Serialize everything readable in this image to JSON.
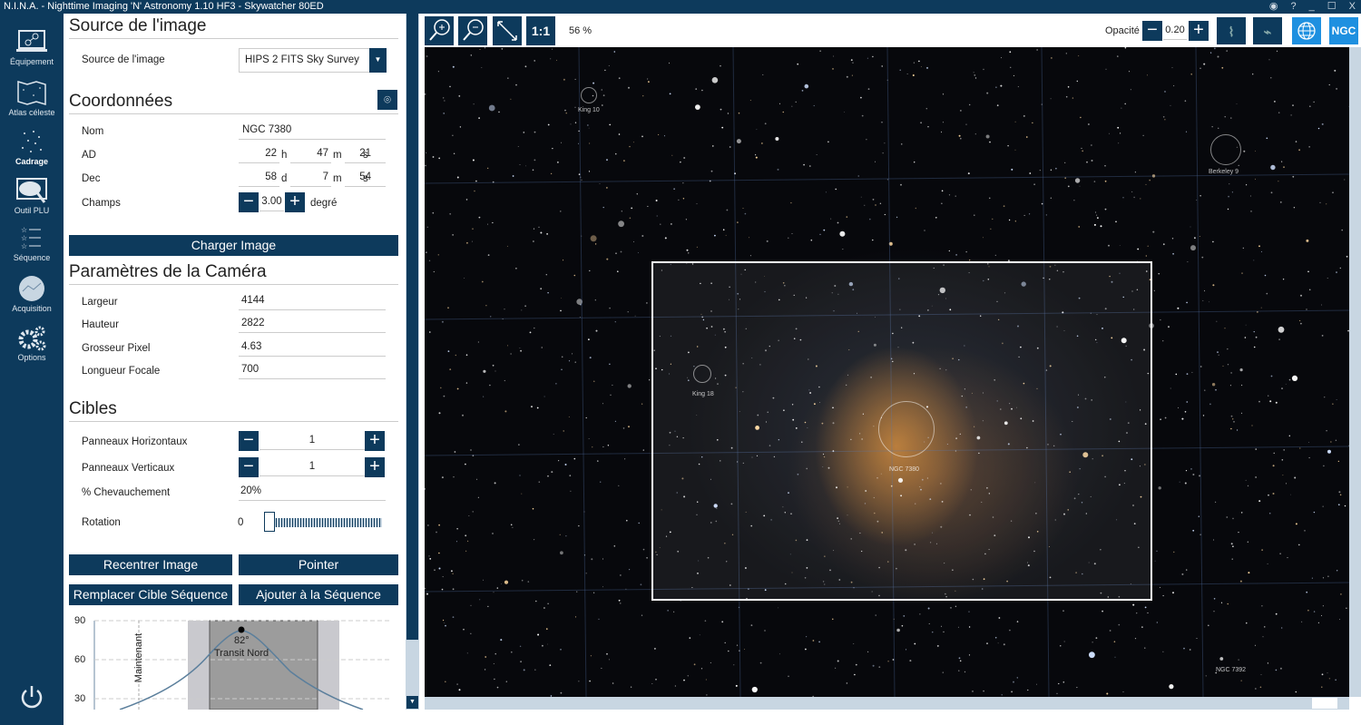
{
  "window": {
    "title": "N.I.N.A. - Nighttime Imaging 'N' Astronomy 1.10 HF3   -  Skywatcher 80ED",
    "controls": [
      "◉",
      "?",
      "_",
      "☐",
      "X"
    ]
  },
  "sidebar": {
    "items": [
      {
        "label": "Équipement",
        "icon": "equipment-icon"
      },
      {
        "label": "Atlas céleste",
        "icon": "sky-atlas-icon"
      },
      {
        "label": "Cadrage",
        "icon": "framing-icon",
        "active": true
      },
      {
        "label": "Outil PLU",
        "icon": "flat-wizard-icon"
      },
      {
        "label": "Séquence",
        "icon": "sequence-icon"
      },
      {
        "label": "Acquisition",
        "icon": "imaging-icon"
      },
      {
        "label": "Options",
        "icon": "gear-icon"
      }
    ]
  },
  "source": {
    "heading": "Source de l'image",
    "label": "Source de l'image",
    "value": "HIPS 2 FITS Sky Survey"
  },
  "coords": {
    "heading": "Coordonnées",
    "name_label": "Nom",
    "name": "NGC 7380",
    "ra_label": "AD",
    "ra_h": "22",
    "ra_h_u": "h",
    "ra_m": "47",
    "ra_m_u": "m",
    "ra_s": "21",
    "ra_s_u": "s",
    "dec_label": "Dec",
    "dec_d": "58",
    "dec_d_u": "d",
    "dec_m": "7",
    "dec_m_u": "m",
    "dec_s": "54",
    "dec_s_u": "s",
    "fov_label": "Champs",
    "fov": "3.00",
    "fov_unit": "degré"
  },
  "load_button": "Charger Image",
  "camera": {
    "heading": "Paramètres de la Caméra",
    "width_label": "Largeur",
    "width": "4144",
    "height_label": "Hauteur",
    "height": "2822",
    "pixel_label": "Grosseur Pixel",
    "pixel": "4.63",
    "focal_label": "Longueur Focale",
    "focal": "700"
  },
  "targets": {
    "heading": "Cibles",
    "hpanels_label": "Panneaux Horizontaux",
    "hpanels": "1",
    "vpanels_label": "Panneaux Verticaux",
    "vpanels": "1",
    "overlap_label": "% Chevauchement",
    "overlap": "20%",
    "rotation_label": "Rotation",
    "rotation": "0"
  },
  "buttons": {
    "recenter": "Recentrer Image",
    "slew": "Pointer",
    "replace": "Remplacer Cible Séquence",
    "add": "Ajouter à la Séquence"
  },
  "altitude_chart": {
    "yticks": [
      "90",
      "60",
      "30"
    ],
    "now_label": "Maintenant",
    "peak": "82°",
    "transit": "Transit Nord",
    "peak_altitude": 82
  },
  "toolbar": {
    "zoom_in": "zoom-in-icon",
    "zoom_out": "zoom-out-icon",
    "fit": "fit-icon",
    "one_to_one": "1:1",
    "zoom": "56 %",
    "opacity_label": "Opacité",
    "opacity": "0.20",
    "ngc": "NGC"
  },
  "sky_labels": {
    "king10": "King 10",
    "berkeley": "Berkeley 9",
    "king18": "King 18",
    "ngc7380": "NGC 7380",
    "ngc7392": "NGC 7392"
  },
  "colors": {
    "accent": "#0d3a5c",
    "light_accent": "#1e90e0"
  }
}
